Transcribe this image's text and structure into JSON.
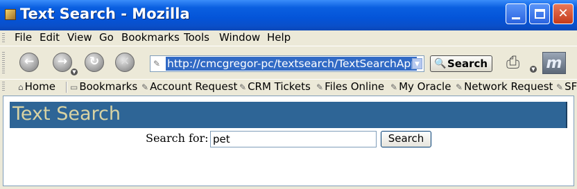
{
  "window": {
    "title": "Text Search - Mozilla"
  },
  "menu": {
    "items": [
      {
        "label": "File"
      },
      {
        "label": "Edit"
      },
      {
        "label": "View"
      },
      {
        "label": "Go"
      },
      {
        "label": "Bookmarks"
      },
      {
        "label": "Tools"
      },
      {
        "label": "Window"
      },
      {
        "label": "Help"
      }
    ]
  },
  "toolbar": {
    "url": "http://cmcgregor-pc/textsearch/TextSearchApp.jsp",
    "search_label": "Search",
    "icons": [
      "back-icon",
      "forward-icon",
      "reload-icon",
      "stop-icon",
      "print-icon",
      "throbber-icon"
    ]
  },
  "personal_toolbar": {
    "items": [
      {
        "label": "Home"
      },
      {
        "label": "Bookmarks"
      },
      {
        "label": "Account Request"
      },
      {
        "label": "CRM Tickets"
      },
      {
        "label": "Files Online"
      },
      {
        "label": "My Oracle"
      },
      {
        "label": "Network Request"
      },
      {
        "label": "SF"
      }
    ]
  },
  "page": {
    "banner_title": "Text Search",
    "search_label": "Search for:",
    "search_value": "pet",
    "search_button": "Search"
  },
  "colors": {
    "banner_bg": "#2e6596",
    "banner_text": "#d9d3a3",
    "url_highlight": "#316ac5"
  }
}
